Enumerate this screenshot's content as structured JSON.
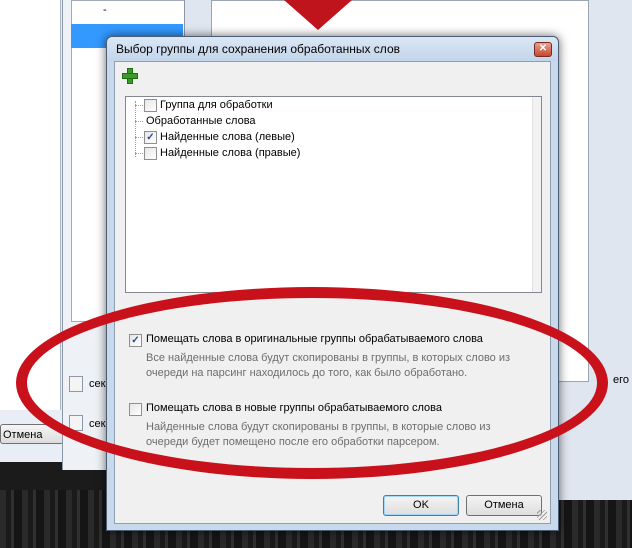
{
  "background": {
    "dash": "-",
    "left_button": "Отмена",
    "sec_label_1": "сек",
    "sec_label_2": "сек",
    "right_fragment": "его",
    "annotation_color": "#c8111b"
  },
  "dialog": {
    "title": "Выбор группы для сохранения обработанных слов",
    "close_glyph": "✕",
    "add_icon": "green-plus-icon",
    "tree": [
      {
        "label": "Группа для обработки",
        "checked": false
      },
      {
        "label": "Обработанные слова",
        "checked": null
      },
      {
        "label": "Найденные слова (левые)",
        "checked": true
      },
      {
        "label": "Найденные слова (правые)",
        "checked": false
      }
    ],
    "option1": {
      "checked": true,
      "label": "Помещать слова в оригинальные группы обрабатываемого слова",
      "description": "Все найденные слова будут скопированы в группы, в которых слово из очереди на парсинг находилось до того, как было обработано."
    },
    "option2": {
      "checked": false,
      "label": "Помещать слова в новые группы обрабатываемого слова",
      "description": "Найденные слова будут скопированы в группы, в которые слово из очереди будет помещено после его обработки парсером."
    },
    "ok_label": "OK",
    "cancel_label": "Отмена"
  }
}
